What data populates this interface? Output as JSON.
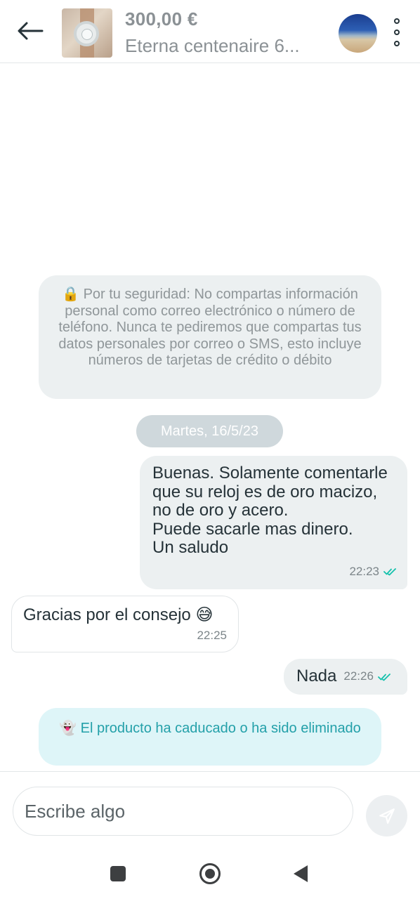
{
  "header": {
    "back_icon": "arrow-left-icon",
    "product_price": "300,00 €",
    "product_title": "Eterna centenaire 6...",
    "more_icon": "more-vertical-icon"
  },
  "chat": {
    "security_notice": "🔒 Por tu seguridad: No compartas información personal como correo electrónico o número de teléfono. Nunca te pediremos que compartas tus datos personales por correo o SMS, esto incluye números de tarjetas de crédito o débito",
    "date_separator": "Martes, 16/5/23",
    "messages": [
      {
        "direction": "sent",
        "text": "Buenas. Solamente comentarle que su reloj es de oro macizo, no de oro y acero.\nPuede sacarle mas dinero.\nUn saludo",
        "time": "22:23",
        "status_icon": "double-check-icon"
      },
      {
        "direction": "received",
        "text": "Gracias por el consejo 😅",
        "time": "22:25"
      },
      {
        "direction": "sent",
        "text": "Nada",
        "time": "22:26",
        "status_icon": "double-check-icon"
      }
    ],
    "expired_notice": "👻 El producto ha caducado o ha sido eliminado"
  },
  "composer": {
    "placeholder": "Escribe algo",
    "value": "",
    "send_icon": "send-icon"
  },
  "system_nav": {
    "recents_icon": "recents-square-icon",
    "home_icon": "home-circle-icon",
    "back_icon": "back-triangle-icon"
  },
  "colors": {
    "accent": "#13c1ac",
    "teal_text": "#23a0a9",
    "bubble_sent": "#ecf0f1",
    "notice_bg": "#ecf0f1",
    "expired_bg": "#def5f8",
    "date_pill_bg": "#cfd8dc"
  }
}
